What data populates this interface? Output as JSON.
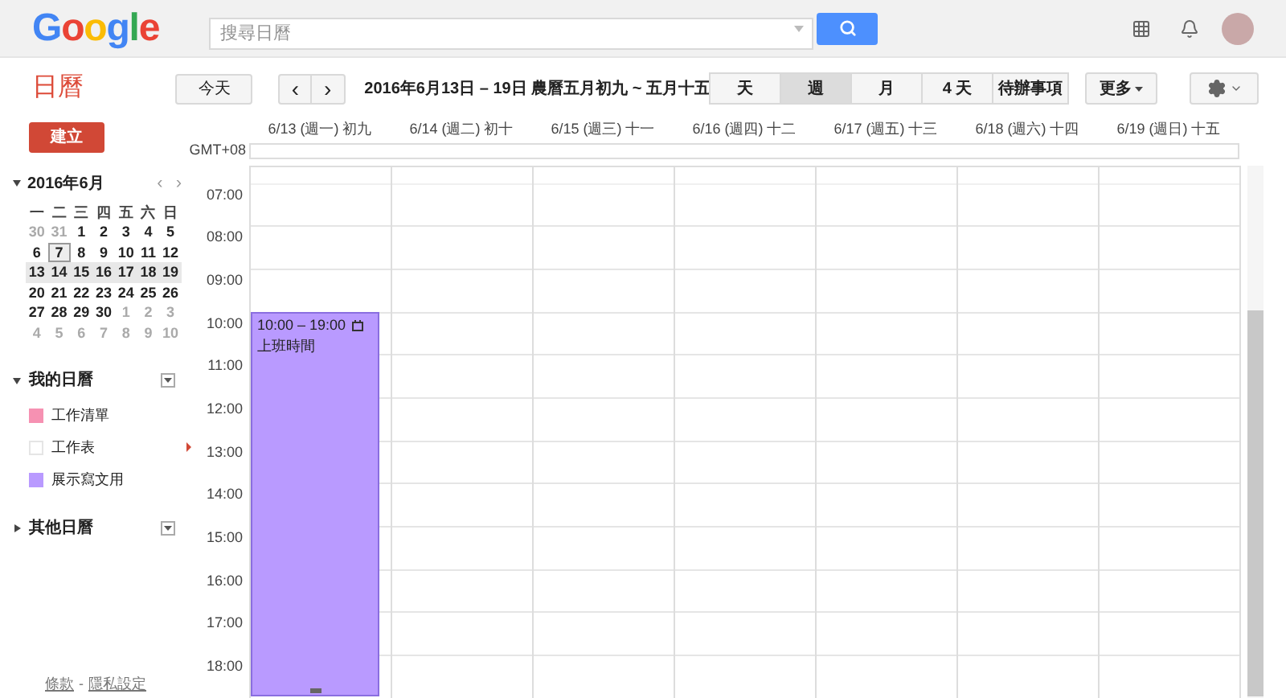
{
  "header": {
    "logo": "Google",
    "search": {
      "placeholder": "搜尋日曆"
    }
  },
  "toolbar": {
    "app_title": "日曆",
    "today": "今天",
    "prev": "‹",
    "next": "›",
    "range": "2016年6月13日 – 19日 農曆五月初九 ~ 五月十五",
    "views": [
      {
        "label": "天",
        "selected": false
      },
      {
        "label": "週",
        "selected": true
      },
      {
        "label": "月",
        "selected": false
      },
      {
        "label": "4 天",
        "selected": false
      },
      {
        "label": "待辦事項",
        "selected": false
      }
    ],
    "more": "更多"
  },
  "sidebar": {
    "create": "建立",
    "mini_calendar": {
      "title": "2016年6月",
      "prev": "‹",
      "next": "›",
      "weekdays": [
        "一",
        "二",
        "三",
        "四",
        "五",
        "六",
        "日"
      ],
      "weeks": [
        {
          "selected": false,
          "days": [
            {
              "label": "30",
              "muted": true,
              "today": false
            },
            {
              "label": "31",
              "muted": true,
              "today": false
            },
            {
              "label": "1",
              "muted": false,
              "today": false
            },
            {
              "label": "2",
              "muted": false,
              "today": false
            },
            {
              "label": "3",
              "muted": false,
              "today": false
            },
            {
              "label": "4",
              "muted": false,
              "today": false
            },
            {
              "label": "5",
              "muted": false,
              "today": false
            }
          ]
        },
        {
          "selected": false,
          "days": [
            {
              "label": "6",
              "muted": false,
              "today": false
            },
            {
              "label": "7",
              "muted": false,
              "today": true
            },
            {
              "label": "8",
              "muted": false,
              "today": false
            },
            {
              "label": "9",
              "muted": false,
              "today": false
            },
            {
              "label": "10",
              "muted": false,
              "today": false
            },
            {
              "label": "11",
              "muted": false,
              "today": false
            },
            {
              "label": "12",
              "muted": false,
              "today": false
            }
          ]
        },
        {
          "selected": true,
          "days": [
            {
              "label": "13",
              "muted": false,
              "today": false
            },
            {
              "label": "14",
              "muted": false,
              "today": false
            },
            {
              "label": "15",
              "muted": false,
              "today": false
            },
            {
              "label": "16",
              "muted": false,
              "today": false
            },
            {
              "label": "17",
              "muted": false,
              "today": false
            },
            {
              "label": "18",
              "muted": false,
              "today": false
            },
            {
              "label": "19",
              "muted": false,
              "today": false
            }
          ]
        },
        {
          "selected": false,
          "days": [
            {
              "label": "20",
              "muted": false,
              "today": false
            },
            {
              "label": "21",
              "muted": false,
              "today": false
            },
            {
              "label": "22",
              "muted": false,
              "today": false
            },
            {
              "label": "23",
              "muted": false,
              "today": false
            },
            {
              "label": "24",
              "muted": false,
              "today": false
            },
            {
              "label": "25",
              "muted": false,
              "today": false
            },
            {
              "label": "26",
              "muted": false,
              "today": false
            }
          ]
        },
        {
          "selected": false,
          "days": [
            {
              "label": "27",
              "muted": false,
              "today": false
            },
            {
              "label": "28",
              "muted": false,
              "today": false
            },
            {
              "label": "29",
              "muted": false,
              "today": false
            },
            {
              "label": "30",
              "muted": false,
              "today": false
            },
            {
              "label": "1",
              "muted": true,
              "today": false
            },
            {
              "label": "2",
              "muted": true,
              "today": false
            },
            {
              "label": "3",
              "muted": true,
              "today": false
            }
          ]
        },
        {
          "selected": false,
          "days": [
            {
              "label": "4",
              "muted": true,
              "today": false
            },
            {
              "label": "5",
              "muted": true,
              "today": false
            },
            {
              "label": "6",
              "muted": true,
              "today": false
            },
            {
              "label": "7",
              "muted": true,
              "today": false
            },
            {
              "label": "8",
              "muted": true,
              "today": false
            },
            {
              "label": "9",
              "muted": true,
              "today": false
            },
            {
              "label": "10",
              "muted": true,
              "today": false
            }
          ]
        }
      ]
    },
    "sections": [
      {
        "title": "我的日曆",
        "expanded": true,
        "calendars": [
          {
            "name": "工作清單",
            "color": "#f691b2",
            "shown": true
          },
          {
            "name": "工作表",
            "color": "#ffffff",
            "shown": false
          },
          {
            "name": "展示寫文用",
            "color": "#b99aff",
            "shown": true
          }
        ]
      },
      {
        "title": "其他日曆",
        "expanded": false
      }
    ],
    "footer": {
      "terms": "條款",
      "separator": "-",
      "privacy": "隱私設定"
    }
  },
  "grid": {
    "timezone": "GMT+08",
    "days": [
      "6/13 (週一) 初九",
      "6/14 (週二) 初十",
      "6/15 (週三) 十一",
      "6/16 (週四) 十二",
      "6/17 (週五) 十三",
      "6/18 (週六) 十四",
      "6/19 (週日) 十五"
    ],
    "hours": [
      "07:00",
      "08:00",
      "09:00",
      "10:00",
      "11:00",
      "12:00",
      "13:00",
      "14:00",
      "15:00",
      "16:00",
      "17:00",
      "18:00"
    ],
    "events": [
      {
        "time": "10:00 – 19:00",
        "title": "上班時間",
        "color": "#b99aff"
      }
    ]
  }
}
